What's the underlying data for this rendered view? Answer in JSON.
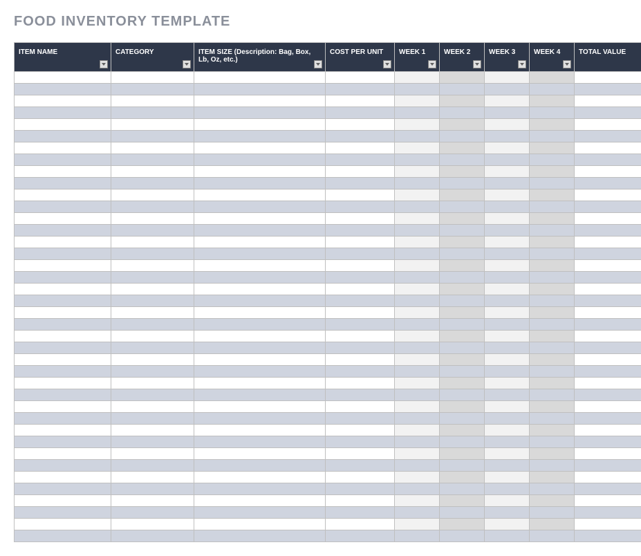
{
  "title": "FOOD INVENTORY  TEMPLATE",
  "columns": [
    {
      "label": "ITEM NAME"
    },
    {
      "label": "CATEGORY"
    },
    {
      "label": "ITEM SIZE (Description: Bag, Box, Lb, Oz, etc.)"
    },
    {
      "label": "COST PER UNIT"
    },
    {
      "label": "WEEK 1"
    },
    {
      "label": "WEEK 2"
    },
    {
      "label": "WEEK 3"
    },
    {
      "label": "WEEK 4"
    },
    {
      "label": "TOTAL VALUE"
    }
  ],
  "row_count": 40,
  "rows": []
}
